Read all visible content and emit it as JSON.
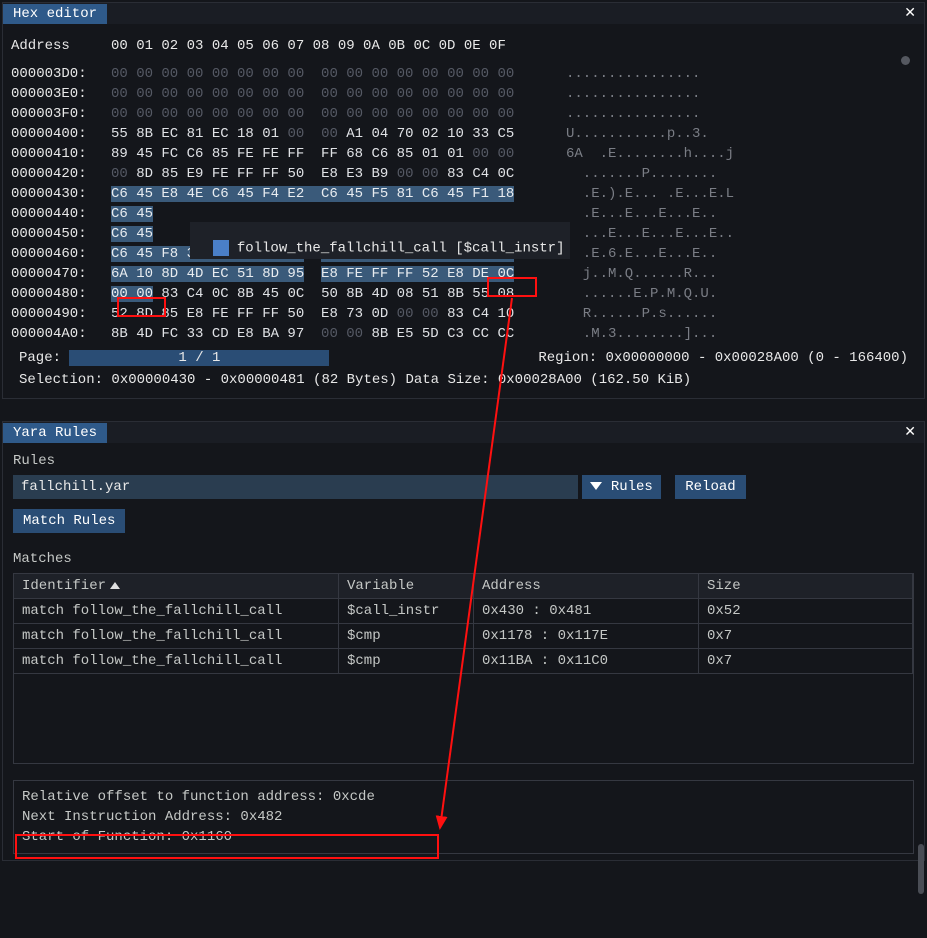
{
  "hex_panel": {
    "title": "Hex editor",
    "header_addr": "Address",
    "header_cols": "00 01 02 03 04 05 06 07  08 09 0A 0B 0C 0D 0E 0F",
    "tooltip": "follow_the_fallchill_call [$call_instr]",
    "rows": [
      {
        "addr": "000003D0:",
        "g1d": "00 00 00 00 00 00 00 00",
        "g2d": "00 00 00 00 00 00 00 00",
        "asc": "................"
      },
      {
        "addr": "000003E0:",
        "g1d": "00 00 00 00 00 00 00 00",
        "g2d": "00 00 00 00 00 00 00 00",
        "asc": "................"
      },
      {
        "addr": "000003F0:",
        "g1d": "00 00 00 00 00 00 00 00",
        "g2d": "00 00 00 00 00 00 00 00",
        "asc": "................"
      },
      {
        "addr": "00000400:",
        "g1": "55 8B EC 81 EC 18 01",
        "g1t": "00",
        "g2t": "00",
        "g2": "A1 04 70 02 10 33 C5",
        "asc": "U...........p..3."
      },
      {
        "addr": "00000410:",
        "g1": "89 45 FC C6 85 FE FE FF",
        "g2": "FF 68 C6 85 01 01",
        "g2t": "00 00",
        "asc": "6A  .E........h....j"
      },
      {
        "addr": "00000420:",
        "g1p": "00",
        "g1": "8D 85 E9 FE FF FF 50",
        "g2": "E8 E3 B9",
        "g2t": "00 00",
        "g2b": "83 C4 0C",
        "asc": "  .......P........"
      },
      {
        "addr": "00000430:",
        "sel": "C6 45 E8 4E C6 45 F4 E2  C6 45 F5 81 C6 45 F1 18",
        "asc": "  .E.).E... .E...E.L"
      },
      {
        "addr": "00000440:",
        "sel": "C6 45",
        "asc": "  .E...E...E...E.."
      },
      {
        "addr": "00000450:",
        "sel": "C6 45",
        "asc": "  ...E...E...E...E.."
      },
      {
        "addr": "00000460:",
        "sela": "C6 45 F8 36 C6 45 F9 E5",
        "selb": "C6 45 FA D5 C6 45 FB 93",
        "asc": "  .E.6.E...E...E.."
      },
      {
        "addr": "00000470:",
        "sela": "6A 10 8D 4D EC 51 8D 95",
        "selb": "E8 FE FF FF 52 E8 DE 0C",
        "asc": "  j..M.Q......R..."
      },
      {
        "addr": "00000480:",
        "sel": "00 00",
        "g1n": "83 C4 0C 8B 45 0C",
        "g2": "50 8B 4D 08 51 8B 55 08",
        "asc": "  ......E.P.M.Q.U."
      },
      {
        "addr": "00000490:",
        "g1": "52 8D 85 E8 FE FF FF 50",
        "g2": "E8 73 0D",
        "g2t": "00 00",
        "g2b": "83 C4 10",
        "asc": "  R......P.s......"
      },
      {
        "addr": "000004A0:",
        "g1": "8B 4D FC 33 CD E8 BA 97",
        "g2t": "00 00",
        "g2": "8B E5 5D C3 CC CC",
        "asc": "  .M.3........]..."
      }
    ],
    "page_label": "Page:",
    "page_text": "1 / 1",
    "region": "Region: 0x00000000 - 0x00028A00 (0 - 166400)",
    "selection": "Selection: 0x00000430 - 0x00000481 (82 Bytes) Data Size: 0x00028A00 (162.50 KiB)"
  },
  "yara_panel": {
    "title": "Yara Rules",
    "rules_label": "Rules",
    "file_value": "fallchill.yar",
    "select_label": "Rules",
    "reload_label": "Reload",
    "match_btn": "Match Rules",
    "matches_label": "Matches",
    "columns": {
      "c1": "Identifier",
      "c2": "Variable",
      "c3": "Address",
      "c4": "Size"
    },
    "rows": [
      {
        "id": "match follow_the_fallchill_call",
        "var": "$call_instr",
        "addr": "0x430 : 0x481",
        "size": "0x52"
      },
      {
        "id": "match follow_the_fallchill_call",
        "var": "$cmp",
        "addr": "0x1178 : 0x117E",
        "size": "0x7"
      },
      {
        "id": "match follow_the_fallchill_call",
        "var": "$cmp",
        "addr": "0x11BA : 0x11C0",
        "size": "0x7"
      }
    ],
    "info": {
      "l1": "Relative offset to function address: 0xcde",
      "l2": "Next Instruction Address: 0x482",
      "l3": "Start of Function: 0x1160"
    }
  }
}
